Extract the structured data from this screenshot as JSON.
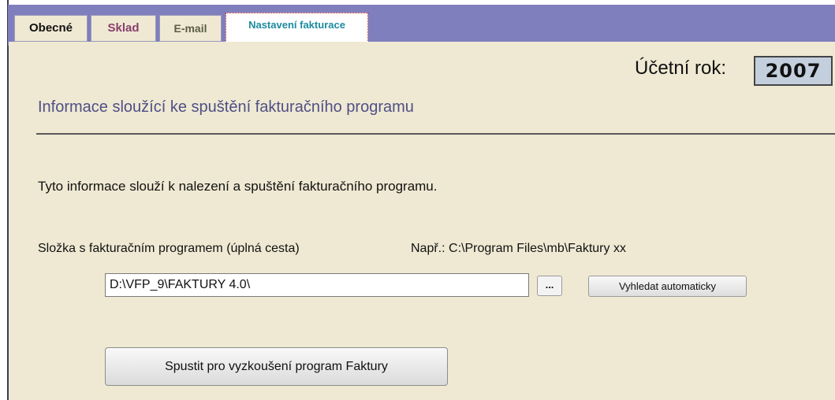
{
  "tabs": [
    {
      "label": "Obecné"
    },
    {
      "label": "Sklad"
    },
    {
      "label": "E-mail"
    },
    {
      "label": "Nastavení fakturace"
    }
  ],
  "active_tab": "Nastavení fakturace",
  "header": {
    "year_label": "Účetní rok:",
    "year_value": "2007"
  },
  "section": {
    "title": "Informace sloužící ke spuštění  fakturačního programu"
  },
  "info_text": "Tyto informace slouží  k nalezení a spuštění fakturačního programu.",
  "folder": {
    "label": "Složka s fakturačním programem  (úplná cesta)",
    "example": "Např.:  C:\\Program Files\\mb\\Faktury xx",
    "path_value": "D:\\VFP_9\\FAKTURY 4.0\\",
    "browse_label": "...",
    "auto_label": "Vyhledat automaticky"
  },
  "run_button_label": "Spustit pro vyzkoušení program Faktury",
  "colors": {
    "tabstrip": "#7f7fbe",
    "panel": "#efe9d3",
    "title_text": "#4f4f86",
    "year_box": "#c4cfdd"
  }
}
